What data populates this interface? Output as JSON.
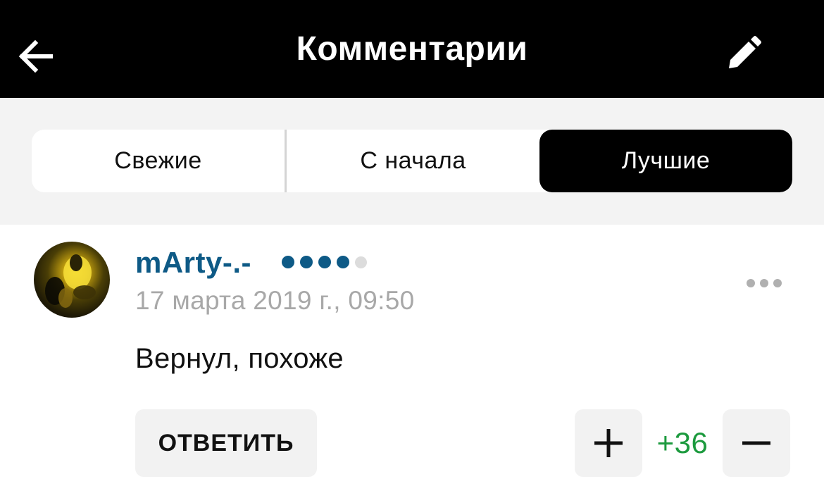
{
  "header": {
    "title": "Комментарии",
    "back_icon": "arrow-left-icon",
    "edit_icon": "pencil-icon"
  },
  "tabs": [
    {
      "label": "Свежие",
      "active": false
    },
    {
      "label": "С начала",
      "active": false
    },
    {
      "label": "Лучшие",
      "active": true
    }
  ],
  "comment": {
    "author": "mArty-.-",
    "author_rating": {
      "filled": 4,
      "total": 5
    },
    "date": "17 марта 2019 г., 09:50",
    "text": "Вернул, похоже",
    "reply_label": "ОТВЕТИТЬ",
    "score": "+36",
    "more_icon": "more-horizontal-icon",
    "upvote_icon": "plus-icon",
    "downvote_icon": "minus-icon"
  },
  "colors": {
    "header_bg": "#000000",
    "author": "#0e5a86",
    "score_positive": "#1c9a3e",
    "muted": "#a8a8a8"
  }
}
